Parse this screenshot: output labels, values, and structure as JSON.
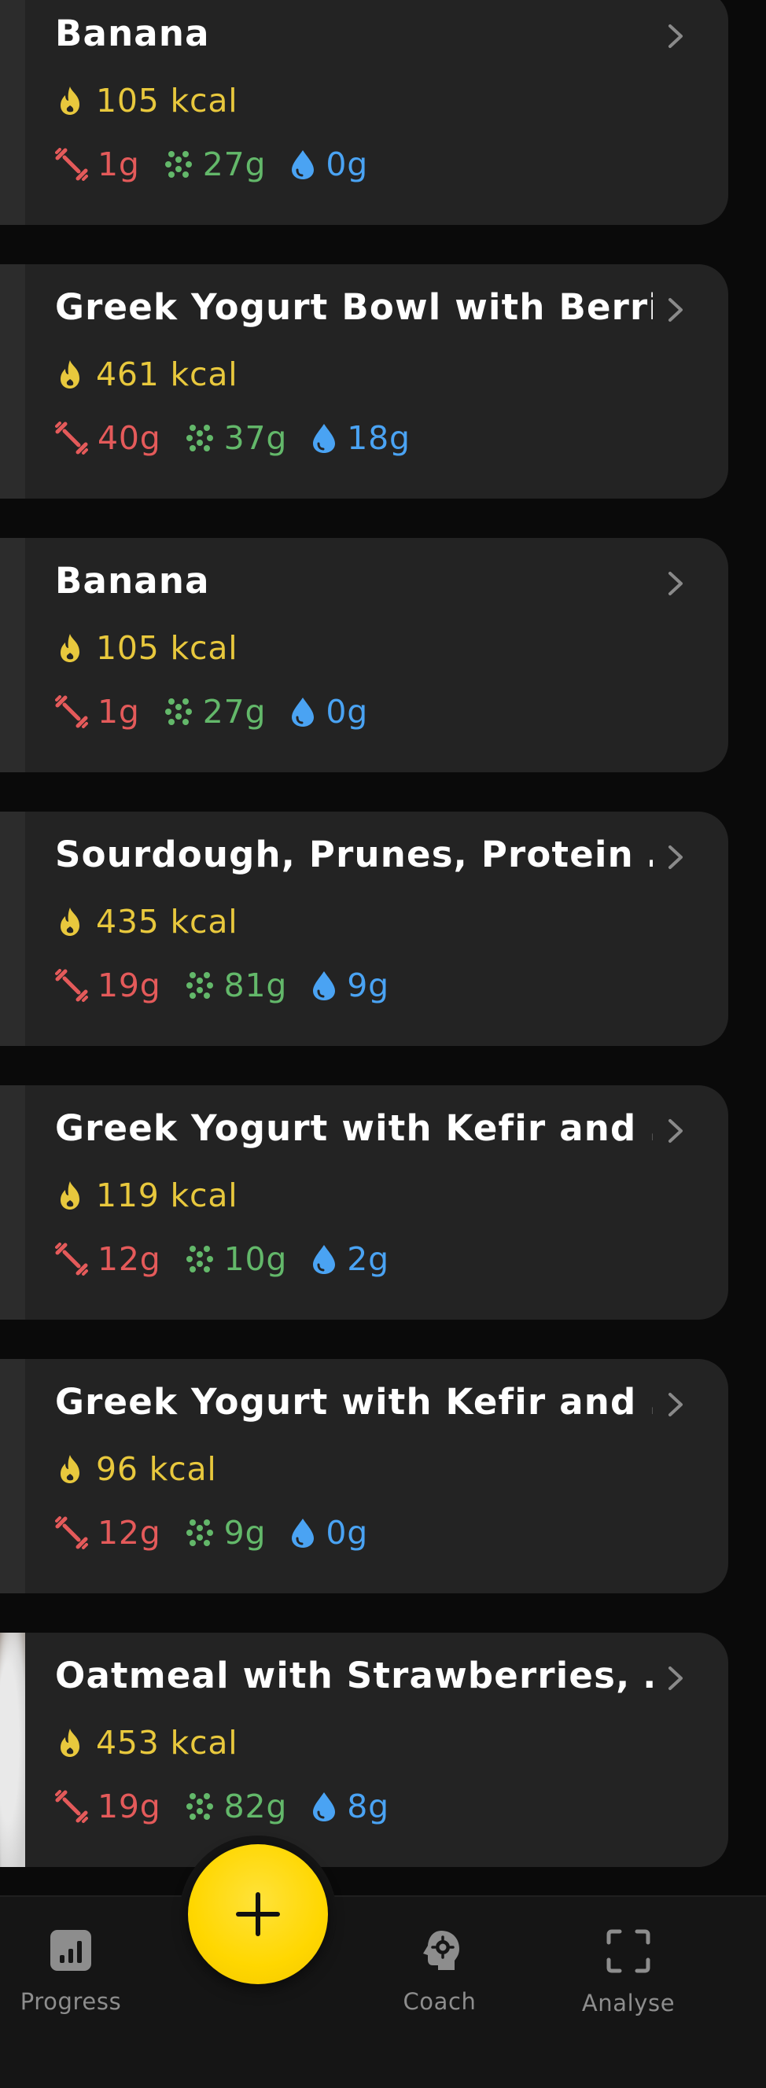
{
  "meals": [
    {
      "title": "Banana",
      "kcal": "105 kcal",
      "protein": "1g",
      "carbs": "27g",
      "fat": "0g"
    },
    {
      "title": "Greek Yogurt Bowl with Berri…",
      "kcal": "461 kcal",
      "protein": "40g",
      "carbs": "37g",
      "fat": "18g"
    },
    {
      "title": "Banana",
      "kcal": "105 kcal",
      "protein": "1g",
      "carbs": "27g",
      "fat": "0g"
    },
    {
      "title": "Sourdough, Prunes, Protein …",
      "kcal": "435 kcal",
      "protein": "19g",
      "carbs": "81g",
      "fat": "9g"
    },
    {
      "title": "Greek Yogurt with Kefir and …",
      "kcal": "119 kcal",
      "protein": "12g",
      "carbs": "10g",
      "fat": "2g"
    },
    {
      "title": "Greek Yogurt with Kefir and …",
      "kcal": "96 kcal",
      "protein": "12g",
      "carbs": "9g",
      "fat": "0g"
    },
    {
      "title": "Oatmeal with Strawberries, …",
      "kcal": "453 kcal",
      "protein": "19g",
      "carbs": "82g",
      "fat": "8g"
    }
  ],
  "nav": {
    "progress": "Progress",
    "coach": "Coach",
    "analyse": "Analyse"
  },
  "icons": {
    "calories": "flame-icon",
    "protein": "dumbbell-icon",
    "carbs": "grain-icon",
    "fat": "drop-icon",
    "open": "chevron-right-icon",
    "add": "plus-icon"
  },
  "colors": {
    "calories": "#e8c83d",
    "protein": "#e45a5a",
    "carbs": "#63b86a",
    "fat": "#4aa3f3",
    "accent": "#ffd700"
  }
}
